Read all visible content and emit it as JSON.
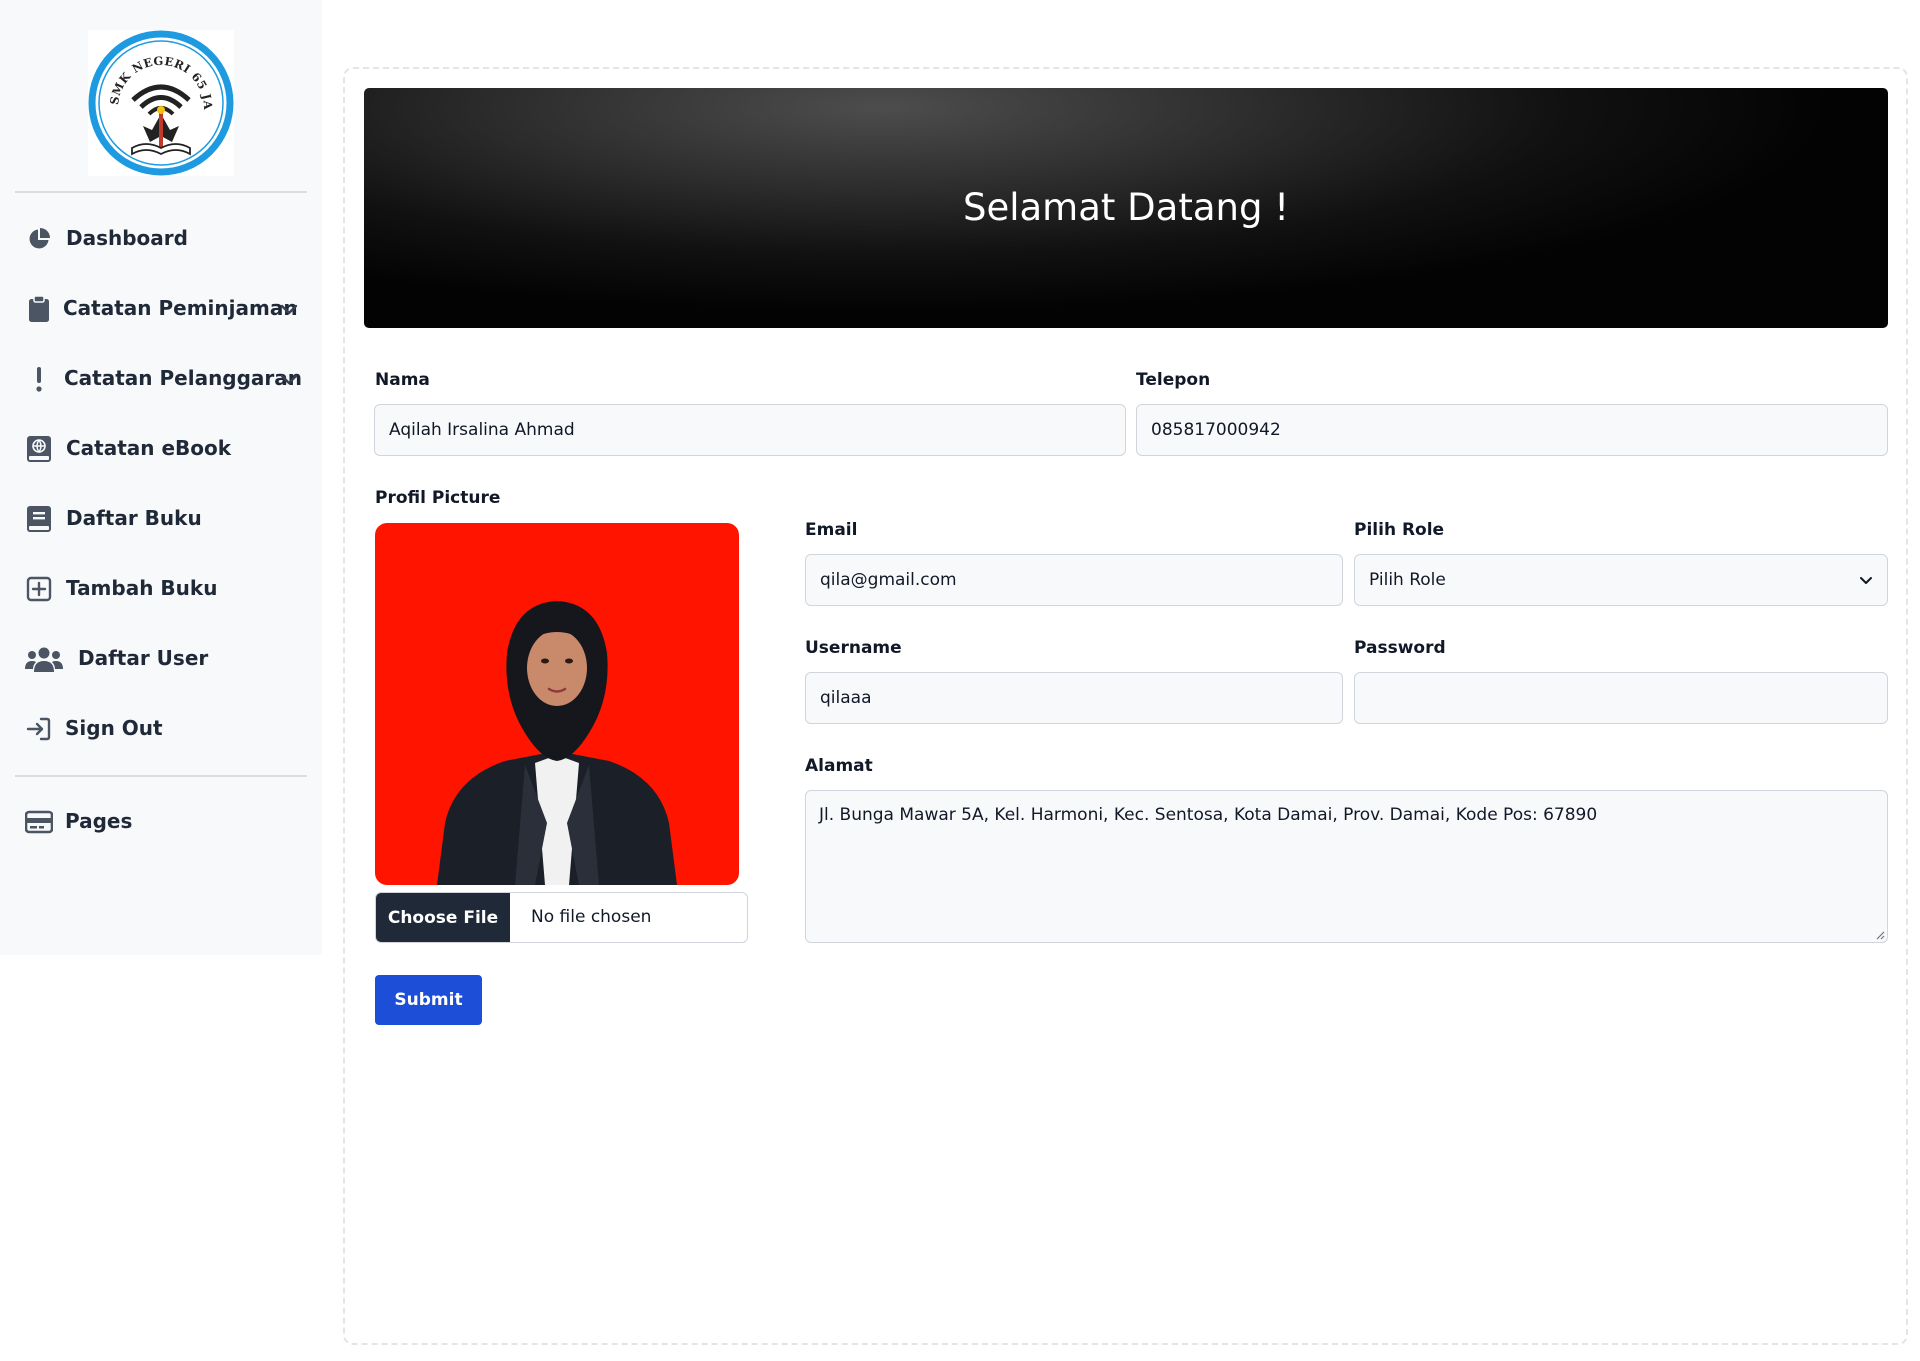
{
  "sidebar": {
    "logo_text": "SMK NEGERI 65 JAKARTA",
    "items": [
      {
        "label": "Dashboard",
        "icon": "chart-pie-icon"
      },
      {
        "label": "Catatan Peminjaman",
        "icon": "clipboard-icon",
        "has_chevron": true
      },
      {
        "label": "Catatan Pelanggaran",
        "icon": "exclamation-icon",
        "has_chevron": true
      },
      {
        "label": "Catatan eBook",
        "icon": "globe-book-icon"
      },
      {
        "label": "Daftar Buku",
        "icon": "book-icon"
      },
      {
        "label": "Tambah Buku",
        "icon": "plus-square-icon"
      },
      {
        "label": "Daftar User",
        "icon": "users-icon"
      },
      {
        "label": "Sign Out",
        "icon": "sign-in-icon"
      },
      {
        "label": "Pages",
        "icon": "card-icon"
      }
    ]
  },
  "header": {
    "title": "Selamat Datang !"
  },
  "form": {
    "nama": {
      "label": "Nama",
      "value": "Aqilah Irsalina Ahmad"
    },
    "telepon": {
      "label": "Telepon",
      "value": "085817000942"
    },
    "profile_picture": {
      "label": "Profil Picture",
      "button": "Choose File",
      "status": "No file chosen"
    },
    "email": {
      "label": "Email",
      "value": "qila@gmail.com"
    },
    "role": {
      "label": "Pilih Role",
      "selected": "Pilih Role"
    },
    "username": {
      "label": "Username",
      "value": "qilaaa"
    },
    "password": {
      "label": "Password",
      "value": ""
    },
    "alamat": {
      "label": "Alamat",
      "value": "Jl. Bunga Mawar 5A, Kel. Harmoni, Kec. Sentosa, Kota Damai, Prov. Damai, Kode Pos: 67890"
    },
    "submit_label": "Submit"
  },
  "colors": {
    "accent": "#1d4ed8",
    "photo_background": "#ff1400",
    "logo_ring": "#1e9be0",
    "sidebar_bg": "#f8f9fb"
  }
}
